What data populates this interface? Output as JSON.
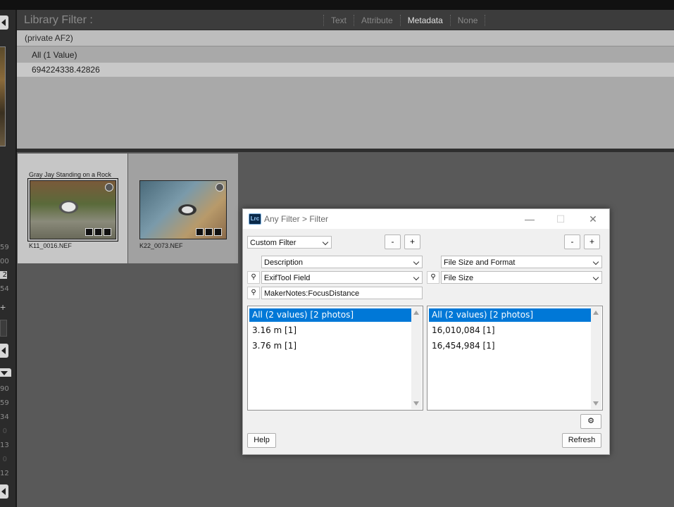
{
  "library_filter": {
    "title": "Library Filter :",
    "tabs": [
      {
        "label": "Text",
        "selected": false
      },
      {
        "label": "Attribute",
        "selected": false
      },
      {
        "label": "Metadata",
        "selected": true
      },
      {
        "label": "None",
        "selected": false
      }
    ]
  },
  "metadata_column": {
    "header": "(private AF2)",
    "rows": [
      "All (1 Value)",
      "694224338.42826"
    ]
  },
  "left_panel": {
    "numbers": [
      "59",
      "00",
      "2",
      "54",
      "90",
      "59",
      "34",
      "0",
      "13",
      "0",
      "12"
    ]
  },
  "grid": {
    "cells": [
      {
        "caption": "Gray Jay Standing on a Rock",
        "filename": "K11_0016.NEF"
      },
      {
        "caption": "",
        "filename": "K22_0073.NEF"
      }
    ]
  },
  "dialog": {
    "icon_text": "Lrc",
    "title": "Any Filter > Filter",
    "window_controls": {
      "minimize": "—",
      "maximize": "☐",
      "close": "✕"
    },
    "custom_filter": "Custom Filter",
    "minus_label": "-",
    "plus_label": "+",
    "pin_icon": "pin-icon",
    "left_column": {
      "category": "Description",
      "field": "ExifTool Field",
      "tag": "MakerNotes:FocusDistance",
      "items": [
        {
          "label": "All (2 values) [2 photos]",
          "selected": true
        },
        {
          "label": "3.16 m [1]",
          "selected": false
        },
        {
          "label": "3.76 m [1]",
          "selected": false
        }
      ]
    },
    "right_column": {
      "category": "File Size and Format",
      "field": "File Size",
      "items": [
        {
          "label": "All (2 values) [2 photos]",
          "selected": true
        },
        {
          "label": "16,010,084 [1]",
          "selected": false
        },
        {
          "label": "16,454,984 [1]",
          "selected": false
        }
      ]
    },
    "settings_icon": "gear-icon",
    "settings_glyph": "⚙",
    "help_label": "Help",
    "refresh_label": "Refresh"
  }
}
